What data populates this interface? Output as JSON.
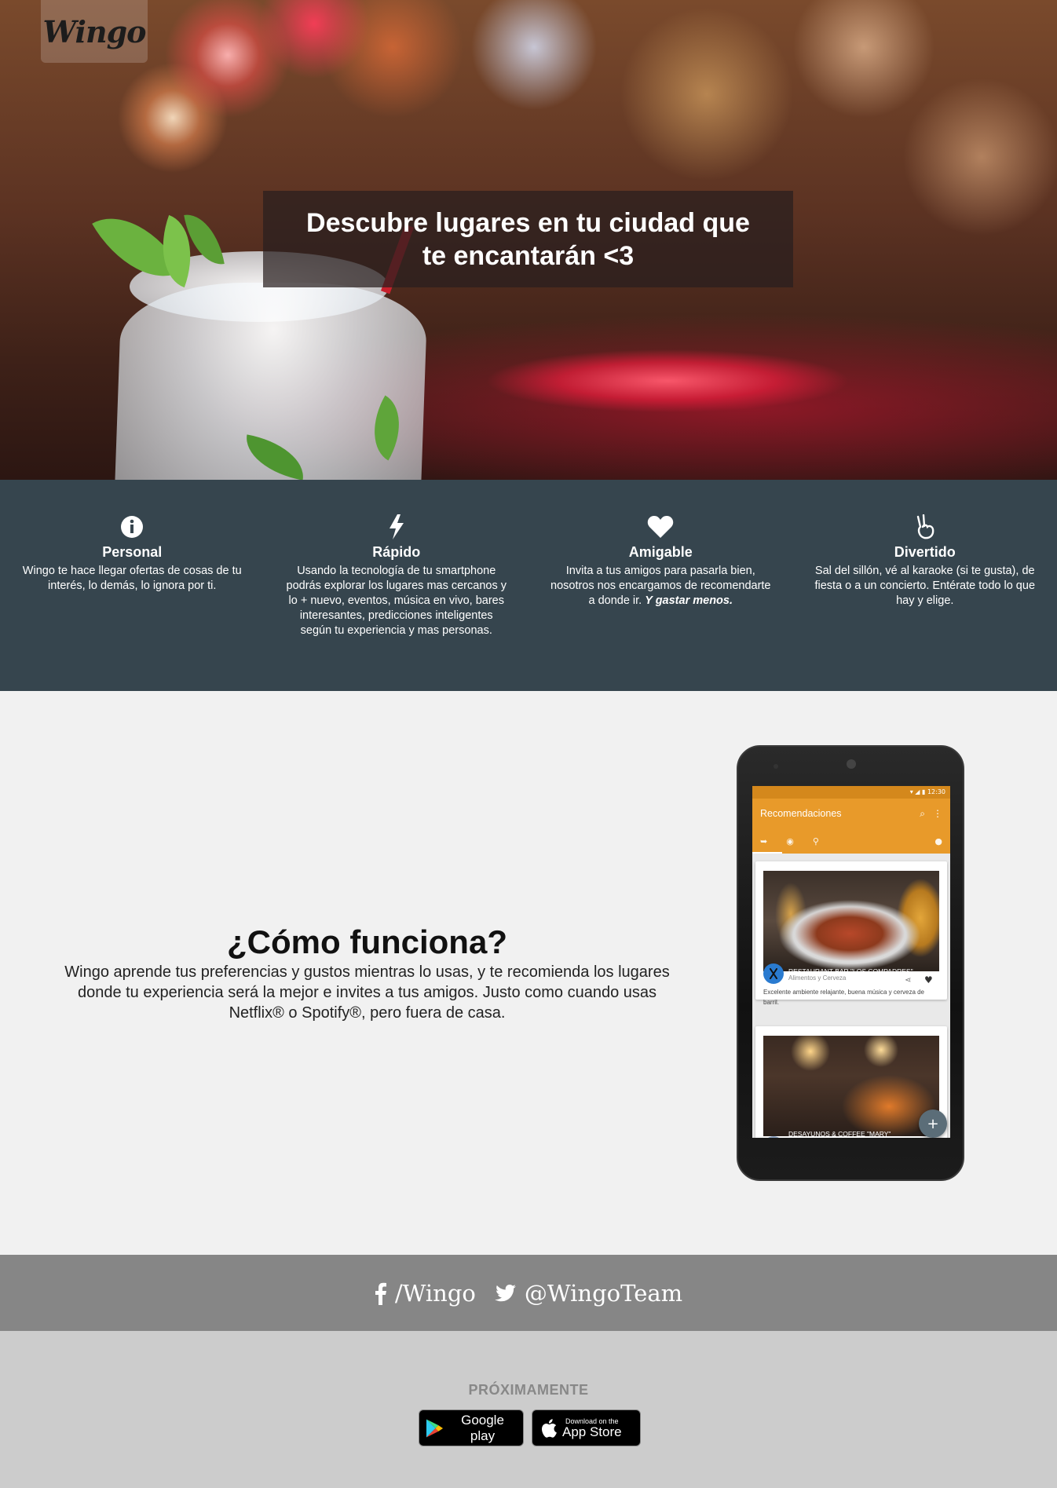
{
  "brand": {
    "logo_text": "Wingo"
  },
  "hero": {
    "headline": "Descubre lugares en tu ciudad que te encantarán <3"
  },
  "features": [
    {
      "icon": "info-icon",
      "title": "Personal",
      "text": "Wingo te hace llegar ofertas de cosas de tu interés, lo demás, lo ignora por ti.",
      "text_em": ""
    },
    {
      "icon": "lightning-icon",
      "title": "Rápido",
      "text": "Usando la tecnología de tu smartphone podrás explorar los lugares mas cercanos y lo + nuevo, eventos, música en vivo, bares interesantes, predicciones inteligentes según tu experiencia y mas personas.",
      "text_em": ""
    },
    {
      "icon": "heart-icon",
      "title": "Amigable",
      "text": "Invita a tus amigos para pasarla bien, nosotros nos encargamos de recomendarte a donde ir.",
      "text_em": "Y gastar menos."
    },
    {
      "icon": "peace-hand-icon",
      "title": "Divertido",
      "text": "Sal del sillón, vé al karaoke (si te gusta), de fiesta o a un concierto. Entérate todo lo que hay y elige.",
      "text_em": ""
    }
  ],
  "how": {
    "title": "¿Cómo funciona?",
    "text": "Wingo aprende tus preferencias y gustos mientras lo usas, y te recomienda los lugares donde tu experiencia será la mejor e invites a tus amigos. Justo como cuando usas Netflix® o Spotify®, pero fuera de casa."
  },
  "phone": {
    "status_time": "12:30",
    "app_title": "Recomendaciones",
    "cards": [
      {
        "name": "RESTAURANT BAR \"LOS COMPADRES\"",
        "category": "Alimentos y Cerveza",
        "description": "Excelente ambiente relajante, buena música y cerveza de barril."
      },
      {
        "name": "DESAYUNOS & COFFEE \"MARY\""
      }
    ],
    "fab": "+"
  },
  "social": {
    "facebook": "/Wingo",
    "twitter": "@WingoTeam"
  },
  "footer": {
    "soon": "PRÓXIMAMENTE",
    "google_play": "Google play",
    "app_store_small": "Download on the",
    "app_store_big": "App Store"
  },
  "colors": {
    "features_bg": "#36454e",
    "app_bar": "#e89a2a",
    "social_bg": "#868686",
    "footer_bg": "#cccccc"
  }
}
